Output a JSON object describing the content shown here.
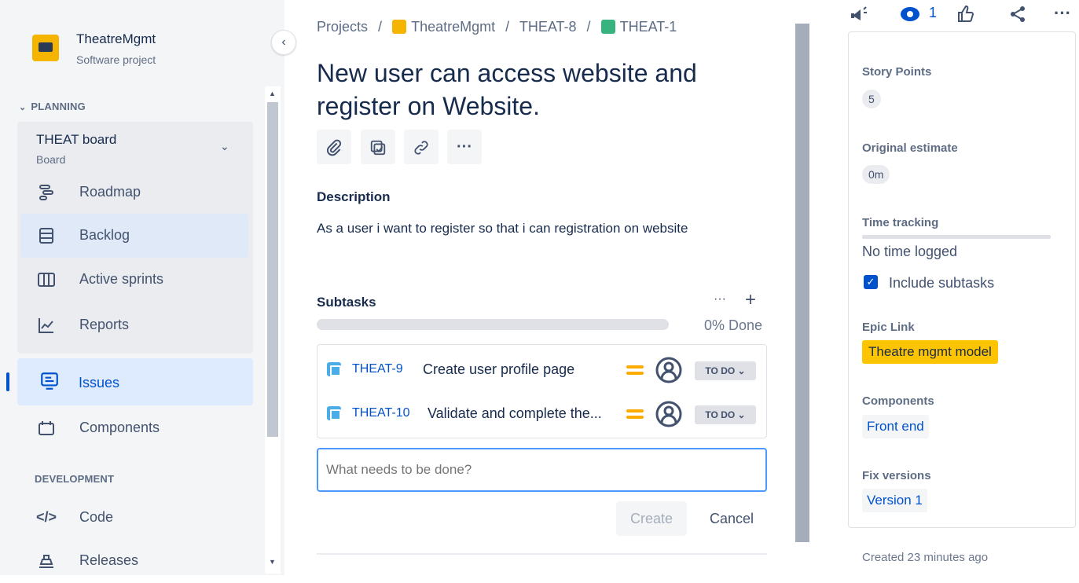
{
  "sidebar": {
    "project_name": "TheatreMgmt",
    "project_type": "Software project",
    "collapse_glyph": "‹",
    "planning_label": "PLANNING",
    "board_title": "THEAT board",
    "board_sub": "Board",
    "board_chevron": "⌄",
    "items": [
      {
        "label": "Roadmap",
        "icon": "roadmap-icon"
      },
      {
        "label": "Backlog",
        "icon": "backlog-icon"
      },
      {
        "label": "Active sprints",
        "icon": "sprints-icon"
      },
      {
        "label": "Reports",
        "icon": "reports-icon"
      },
      {
        "label": "Issues",
        "icon": "issues-icon"
      },
      {
        "label": "Components",
        "icon": "components-icon"
      }
    ],
    "development_label": "DEVELOPMENT",
    "dev_items": [
      {
        "label": "Code",
        "glyph": "</>"
      },
      {
        "label": "Releases",
        "icon": "releases-icon"
      }
    ]
  },
  "breadcrumb": {
    "projects": "Projects",
    "sep": "/",
    "project": "TheatreMgmt",
    "parent": "THEAT-8",
    "issue": "THEAT-1"
  },
  "issue": {
    "title": "New user can access website and register on Website.",
    "more_glyph": "···",
    "description_label": "Description",
    "description": "As a user i want to register so that i can registration on website"
  },
  "subtasks": {
    "label": "Subtasks",
    "more": "···",
    "add": "+",
    "progress": 0,
    "done_text": "0% Done",
    "rows": [
      {
        "key": "THEAT-9",
        "summary": "Create user profile page",
        "status": "TO DO ⌄"
      },
      {
        "key": "THEAT-10",
        "summary": "Validate and complete the...",
        "status": "TO DO ⌄"
      }
    ],
    "placeholder": "What needs to be done?",
    "create_label": "Create",
    "cancel_label": "Cancel"
  },
  "right": {
    "watch_count": "1",
    "more": "···",
    "fields": {
      "story_points_label": "Story Points",
      "story_points": "5",
      "estimate_label": "Original estimate",
      "estimate": "0m",
      "time_tracking_label": "Time tracking",
      "time_logged": "No time logged",
      "include_subtasks": "Include subtasks",
      "epic_label": "Epic Link",
      "epic": "Theatre mgmt model",
      "components_label": "Components",
      "component": "Front end",
      "fix_versions_label": "Fix versions",
      "fix_version": "Version 1"
    },
    "created": "Created 23 minutes ago"
  },
  "colors": {
    "accent": "#0052cc",
    "epic": "#ffc400",
    "priority": "#ffab00",
    "subtask_icon": "#4bade8",
    "story_icon": "#36b37e"
  }
}
